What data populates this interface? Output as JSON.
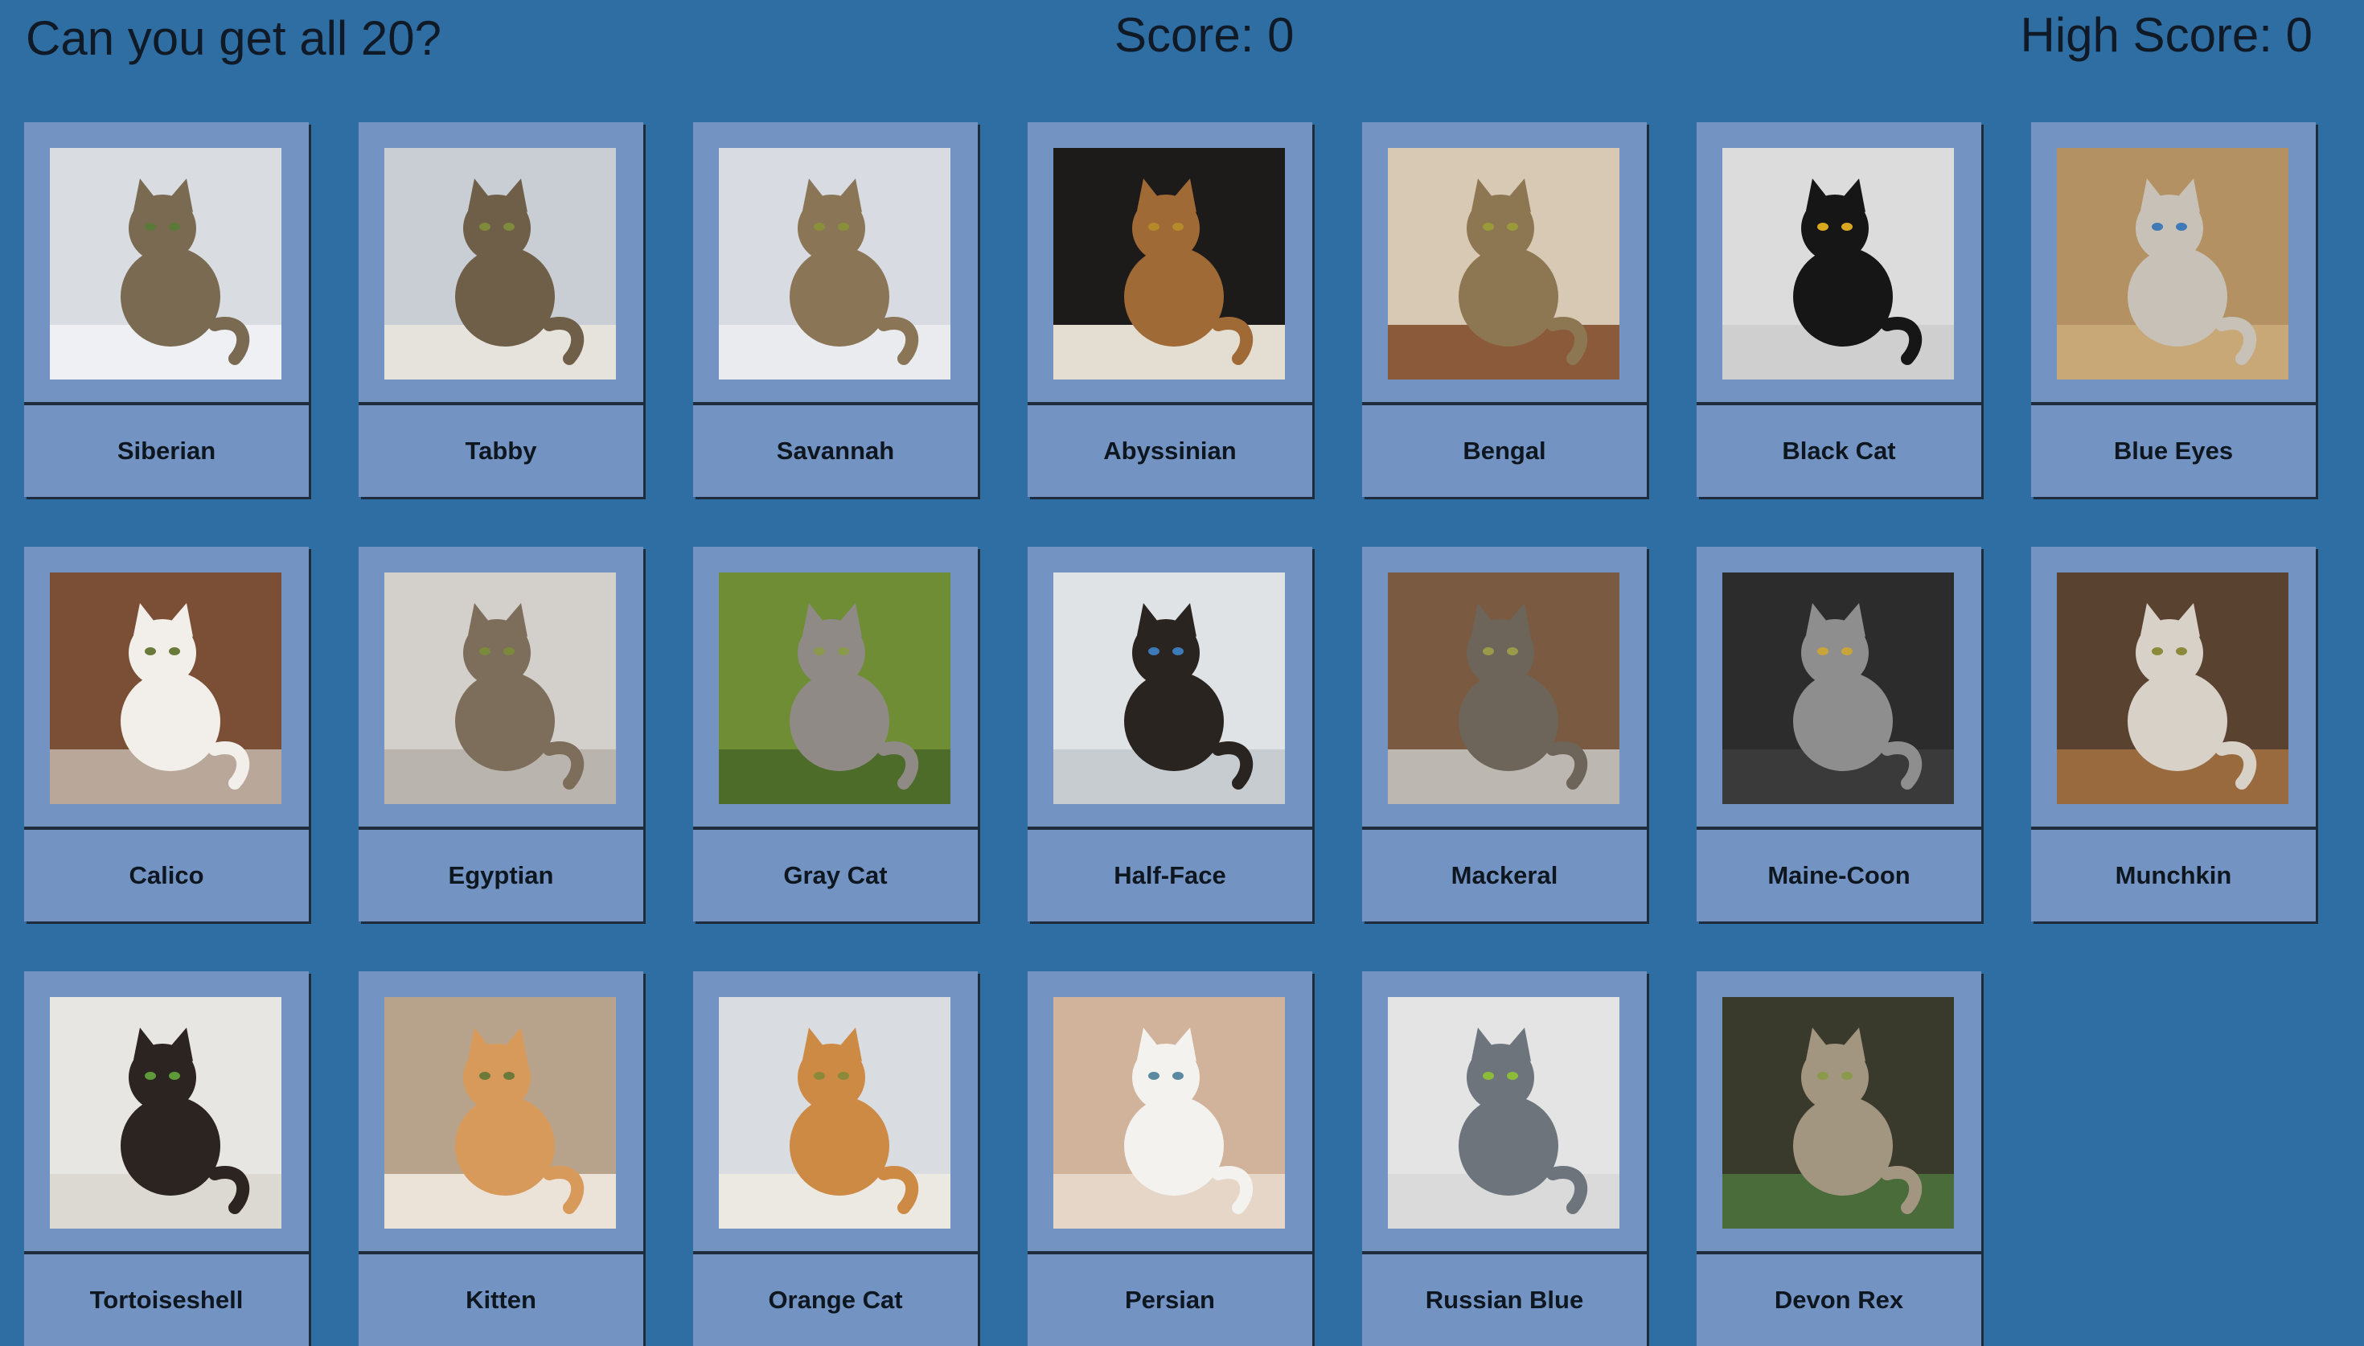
{
  "header": {
    "title": "Can you get all 20?",
    "score": "Score: 0",
    "high_score": "High Score: 0"
  },
  "cards": [
    {
      "label": "Siberian",
      "bg": "#d9dde2",
      "ground": "#eef0f3",
      "cat": "#7a6a52",
      "eye": "#5b7a3a"
    },
    {
      "label": "Tabby",
      "bg": "#c9ced4",
      "ground": "#e6e2dc",
      "cat": "#6f5f49",
      "eye": "#7f8a3a"
    },
    {
      "label": "Savannah",
      "bg": "#d8dbe1",
      "ground": "#e9ebef",
      "cat": "#8a7656",
      "eye": "#8a8f3a"
    },
    {
      "label": "Abyssinian",
      "bg": "#1d1a1a",
      "ground": "#e3ddd2",
      "cat": "#a06a36",
      "eye": "#b48a2a"
    },
    {
      "label": "Bengal",
      "bg": "#d8c9b4",
      "ground": "#8a5a3a",
      "cat": "#8d7652",
      "eye": "#9a9a3a"
    },
    {
      "label": "Black Cat",
      "bg": "#dcdcdc",
      "ground": "#cfcfcf",
      "cat": "#161616",
      "eye": "#d9a820"
    },
    {
      "label": "Blue Eyes",
      "bg": "#b39162",
      "ground": "#c9a878",
      "cat": "#c7c1b8",
      "eye": "#3f79b6"
    },
    {
      "label": "Calico",
      "bg": "#7a4f35",
      "ground": "#b9a89a",
      "cat": "#f2efea",
      "eye": "#6a7a3a"
    },
    {
      "label": "Egyptian",
      "bg": "#d3d0cb",
      "ground": "#b9b5ae",
      "cat": "#7c6e5b",
      "eye": "#7a8a3a"
    },
    {
      "label": "Gray Cat",
      "bg": "#6f8d34",
      "ground": "#4d6b29",
      "cat": "#8f8a85",
      "eye": "#8a9a4a"
    },
    {
      "label": "Half-Face",
      "bg": "#dfe3e6",
      "ground": "#c7ccd1",
      "cat": "#2a2420",
      "eye": "#3c7ab8"
    },
    {
      "label": "Mackeral",
      "bg": "#7a5a40",
      "ground": "#bcb7b0",
      "cat": "#6d6559",
      "eye": "#9a9a4a"
    },
    {
      "label": "Maine-Coon",
      "bg": "#2c2c2c",
      "ground": "#3a3a3a",
      "cat": "#8e8e8e",
      "eye": "#c9a43a"
    },
    {
      "label": "Munchkin",
      "bg": "#5a4230",
      "ground": "#9a6a3f",
      "cat": "#d7d1c8",
      "eye": "#8a8a3a"
    },
    {
      "label": "Tortoiseshell",
      "bg": "#e8e6e2",
      "ground": "#dcd8d2",
      "cat": "#2b2420",
      "eye": "#5f9a3a"
    },
    {
      "label": "Kitten",
      "bg": "#b7a38c",
      "ground": "#ece3d8",
      "cat": "#d89a5a",
      "eye": "#6b7a3a"
    },
    {
      "label": "Orange Cat",
      "bg": "#d9dde2",
      "ground": "#ece8e2",
      "cat": "#cc8a45",
      "eye": "#8a8a3a"
    },
    {
      "label": "Persian",
      "bg": "#d1b39c",
      "ground": "#e6d6c7",
      "cat": "#f4f2ee",
      "eye": "#5a8aa0"
    },
    {
      "label": "Russian Blue",
      "bg": "#e4e4e4",
      "ground": "#dadada",
      "cat": "#6d747c",
      "eye": "#8cbc3a"
    },
    {
      "label": "Devon Rex",
      "bg": "#3a3a2c",
      "ground": "#4a6b3a",
      "cat": "#a39680",
      "eye": "#8a9a4a"
    }
  ]
}
